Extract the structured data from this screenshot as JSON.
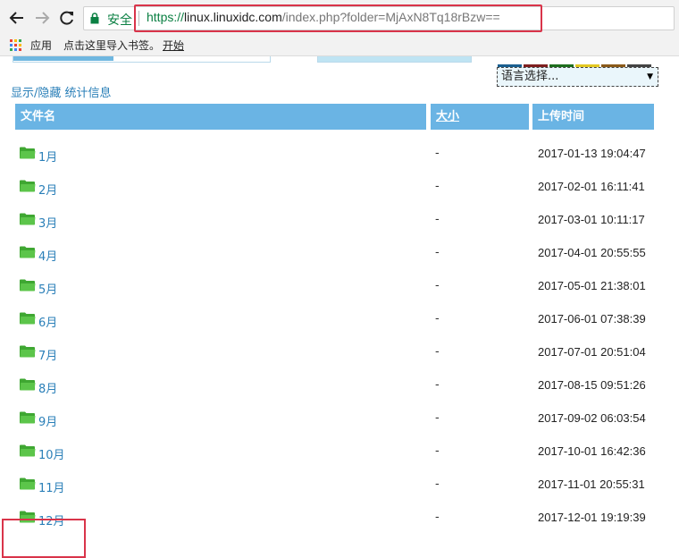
{
  "browser": {
    "secure_label": "安全",
    "url": {
      "scheme": "https://",
      "host": "linux.linuxidc.com",
      "path": "/index.php?folder=MjAxN8Tq18rBzw=="
    },
    "bookmarks": {
      "apps_label": "应用",
      "import_text": "点击这里导入书签。",
      "start_link": "开始"
    }
  },
  "page": {
    "language_select": {
      "value": "语言选择..."
    },
    "toggle_stats_link": "显示/隐藏 统计信息",
    "swatch_colors": [
      "#1a5f8f",
      "#7e1f1f",
      "#1e6e1e",
      "#e3c822",
      "#8a5a1a",
      "#444444"
    ],
    "columns": {
      "name": "文件名",
      "size": "大小",
      "uploaded": "上传时间"
    },
    "files": [
      {
        "name": "1月",
        "size": "-",
        "uploaded": "2017-01-13 19:04:47"
      },
      {
        "name": "2月",
        "size": "-",
        "uploaded": "2017-02-01 16:11:41"
      },
      {
        "name": "3月",
        "size": "-",
        "uploaded": "2017-03-01 10:11:17"
      },
      {
        "name": "4月",
        "size": "-",
        "uploaded": "2017-04-01 20:55:55"
      },
      {
        "name": "5月",
        "size": "-",
        "uploaded": "2017-05-01 21:38:01"
      },
      {
        "name": "6月",
        "size": "-",
        "uploaded": "2017-06-01 07:38:39"
      },
      {
        "name": "7月",
        "size": "-",
        "uploaded": "2017-07-01 20:51:04"
      },
      {
        "name": "8月",
        "size": "-",
        "uploaded": "2017-08-15 09:51:26"
      },
      {
        "name": "9月",
        "size": "-",
        "uploaded": "2017-09-02 06:03:54"
      },
      {
        "name": "10月",
        "size": "-",
        "uploaded": "2017-10-01 16:42:36"
      },
      {
        "name": "11月",
        "size": "-",
        "uploaded": "2017-11-01 20:55:31"
      },
      {
        "name": "12月",
        "size": "-",
        "uploaded": "2017-12-01 19:19:39"
      }
    ],
    "accent_color": "#6ab4e4",
    "link_color": "#2a7fb8",
    "highlight_color": "#d9344a"
  }
}
